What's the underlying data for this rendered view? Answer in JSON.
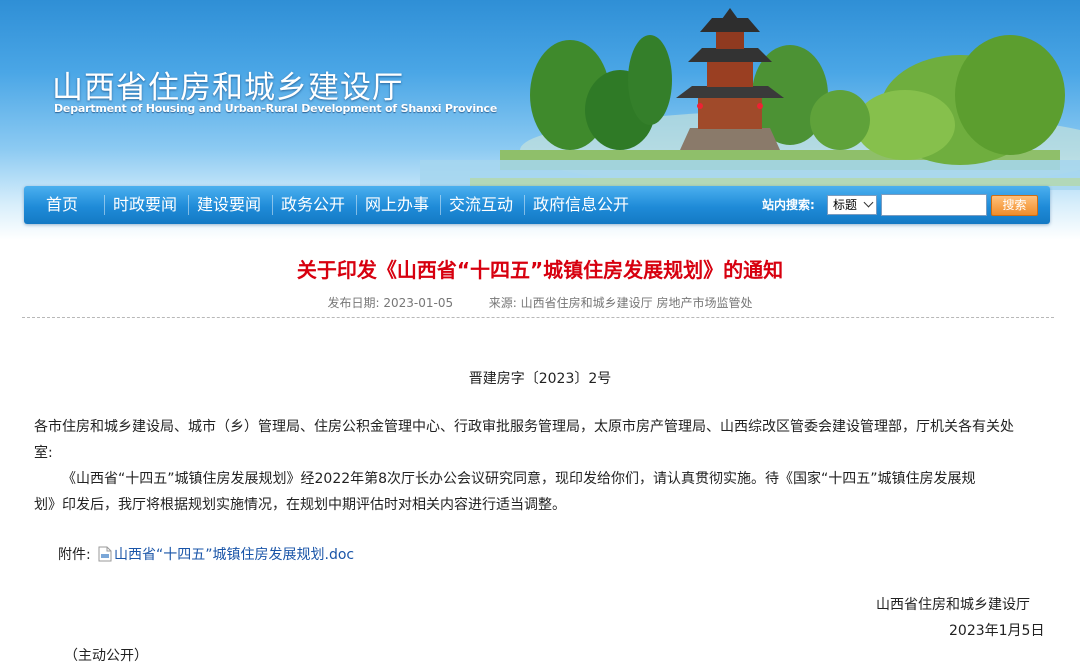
{
  "header": {
    "site_title": "山西省住房和城乡建设厅",
    "site_subtitle": "Department of Housing and Urban-Rural Development of Shanxi Province"
  },
  "nav": {
    "items": [
      {
        "label": "首页"
      },
      {
        "label": "时政要闻"
      },
      {
        "label": "建设要闻"
      },
      {
        "label": "政务公开"
      },
      {
        "label": "网上办事"
      },
      {
        "label": "交流互动"
      },
      {
        "label": "政府信息公开"
      }
    ]
  },
  "search": {
    "label": "站内搜索:",
    "select_value": "标题",
    "input_value": "",
    "button_label": "搜索"
  },
  "article": {
    "title": "关于印发《山西省“十四五”城镇住房发展规划》的通知",
    "date_label": "发布日期:",
    "date": "2023-01-05",
    "source_label": "来源:",
    "source": "山西省住房和城乡建设厅 房地产市场监管处",
    "doc_number": "晋建房字〔2023〕2号",
    "recipients_line1": "各市住房和城乡建设局、城市（乡）管理局、住房公积金管理中心、行政审批服务管理局，太原市房产管理局、山西综改区管委会建设管理部，厅机关各有关处",
    "recipients_line2": "室:",
    "body_line1": "《山西省“十四五”城镇住房发展规划》经2022年第8次厅长办公会议研究同意，现印发给你们，请认真贯彻实施。待《国家“十四五”城镇住房发展规",
    "body_line2": "划》印发后，我厅将根据规划实施情况，在规划中期评估时对相关内容进行适当调整。",
    "attachment_label": "附件:",
    "attachment_name": "山西省“十四五”城镇住房发展规划.doc",
    "signature_org": "山西省住房和城乡建设厅",
    "signature_date": "2023年1月5日",
    "public_note": "（主动公开）"
  },
  "colors": {
    "title_red": "#d7000f",
    "nav_blue": "#1f8bd8",
    "link_blue": "#1a55a8",
    "search_button_orange": "#f08d2b"
  },
  "icons": {
    "attachment": "doc-file-icon",
    "select_caret": "chevron-down-icon"
  }
}
